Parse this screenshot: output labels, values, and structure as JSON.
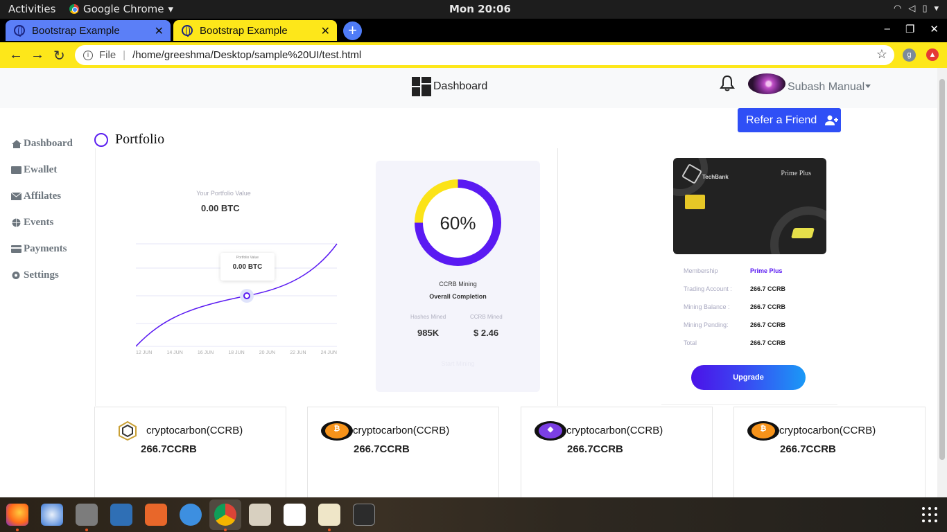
{
  "system": {
    "activities": "Activities",
    "app_name": "Google Chrome",
    "clock": "Mon 20:06"
  },
  "browser": {
    "tabs": [
      {
        "title": "Bootstrap Example",
        "active": false
      },
      {
        "title": "Bootstrap Example",
        "active": true
      }
    ],
    "file_label": "File",
    "url": "/home/greeshma/Desktop/sample%20UI/test.html",
    "extension_g": "g",
    "accent_color": "#fde71a"
  },
  "navbar": {
    "brand": "Dashboard",
    "user_name": "Subash Manual"
  },
  "refer_button": "Refer a Friend",
  "sidebar": {
    "items": [
      {
        "label": "Dashboard",
        "icon": "home-icon"
      },
      {
        "label": "Ewallet",
        "icon": "wallet-icon"
      },
      {
        "label": "Affilates",
        "icon": "envelope-icon"
      },
      {
        "label": "Events",
        "icon": "globe-icon"
      },
      {
        "label": "Payments",
        "icon": "credit-card-icon"
      },
      {
        "label": "Settings",
        "icon": "gear-icon"
      }
    ]
  },
  "portfolio": {
    "title": "Portfolio",
    "chart_label": "Your Portfolio Value",
    "chart_value": "0.00 BTC",
    "tooltip_label": "Portfolio Value",
    "tooltip_value": "0.00 BTC",
    "x_ticks": [
      "12 JUN",
      "14 JUN",
      "16 JUN",
      "18 JUN",
      "20 JUN",
      "22 JUN",
      "24 JUN"
    ]
  },
  "chart_data": {
    "type": "line",
    "title": "Your Portfolio Value",
    "categories": [
      "12 JUN",
      "14 JUN",
      "16 JUN",
      "18 JUN",
      "20 JUN",
      "22 JUN",
      "24 JUN"
    ]
  },
  "mining": {
    "percent": "60%",
    "percent_value": 0.75,
    "title": "CCRB Mining",
    "subtitle": "Overall Completion",
    "hashes_label": "Hashes Mined",
    "hashes_value": "985K",
    "ccrb_label": "CCRB Mined",
    "ccrb_value": "$ 2.46",
    "start_label": "Start Mining"
  },
  "membership": {
    "bank_name": "TechBank",
    "tier": "Prime Plus",
    "rows": [
      {
        "key": "Membership",
        "value": "Prime Plus"
      },
      {
        "key": "Trading Account :",
        "value": "266.7 CCRB"
      },
      {
        "key": "Mining Balance :",
        "value": "266.7 CCRB"
      },
      {
        "key": "Mining Pending:",
        "value": "266.7 CCRB"
      },
      {
        "key": "Total",
        "value": "266.7 CCRB"
      }
    ],
    "upgrade_label": "Upgrade"
  },
  "coins": [
    {
      "name": "cryptocarbon(CCRB)",
      "amount": "266.7CCRB",
      "icon": "ccrb-hex-icon",
      "color": "#c9a035"
    },
    {
      "name": "cryptocarbon(CCRB)",
      "amount": "266.7CCRB",
      "icon": "bitcoin-icon",
      "color": "#f7931a"
    },
    {
      "name": "cryptocarbon(CCRB)",
      "amount": "266.7CCRB",
      "icon": "ethereum-icon",
      "color": "#7b3fe4"
    },
    {
      "name": "cryptocarbon(CCRB)",
      "amount": "266.7CCRB",
      "icon": "bitcoin-icon",
      "color": "#f7931a"
    }
  ],
  "dock": {
    "apps": [
      "firefox-icon",
      "thunderbird-icon",
      "files-icon",
      "writer-icon",
      "software-icon",
      "help-icon",
      "chrome-icon",
      "rhythmbox-icon",
      "amazon-icon",
      "text-editor-icon",
      "terminal-icon"
    ]
  }
}
